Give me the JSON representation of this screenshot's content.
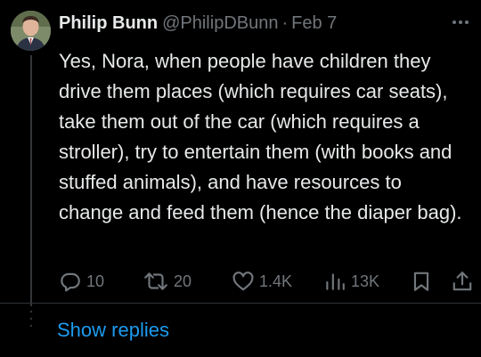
{
  "tweet": {
    "author": {
      "display_name": "Philip Bunn",
      "handle": "@PhilipDBunn",
      "separator": "·",
      "date": "Feb 7"
    },
    "more_icon": "more-horizontal-icon",
    "text": "Yes, Nora, when people have children they drive them places (which requires car seats), take them out of the car (which requires a stroller), try to entertain them (with books and stuffed animals), and have resources to change and feed them (hence the diaper bag).",
    "actions": {
      "replies": "10",
      "reposts": "20",
      "likes": "1.4K",
      "views": "13K"
    }
  },
  "show_replies_label": "Show replies",
  "colors": {
    "background": "#000000",
    "text_primary": "#e7e9ea",
    "text_secondary": "#71767b",
    "link": "#1d9bf0",
    "divider": "#2f3336"
  }
}
